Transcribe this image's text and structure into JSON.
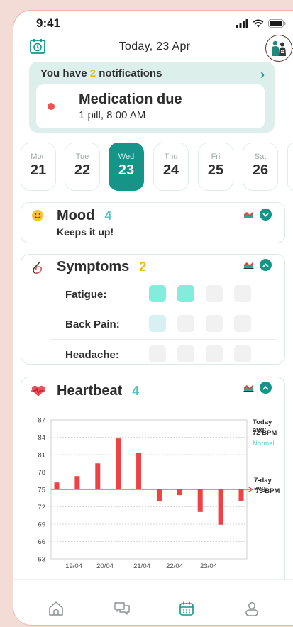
{
  "status": {
    "time": "9:41"
  },
  "header": {
    "date": "Today, 23 Apr"
  },
  "notifications": {
    "prefix": "You have",
    "count": "2",
    "suffix": "notifications",
    "item": {
      "title": "Medication due",
      "detail": "1 pill, 8:00 AM"
    }
  },
  "days": [
    {
      "name": "Mon",
      "num": "21",
      "active": false
    },
    {
      "name": "Tue",
      "num": "22",
      "active": false
    },
    {
      "name": "Wed",
      "num": "23",
      "active": true
    },
    {
      "name": "Thu",
      "num": "24",
      "active": false
    },
    {
      "name": "Fri",
      "num": "25",
      "active": false
    },
    {
      "name": "Sat",
      "num": "26",
      "active": false
    }
  ],
  "mood": {
    "title": "Mood",
    "value": "4",
    "note": "Keeps it up!"
  },
  "symptoms": {
    "title": "Symptoms",
    "value": "2",
    "rows": [
      {
        "label": "Fatigue:",
        "levels": [
          "teal",
          "teal",
          "none",
          "none"
        ]
      },
      {
        "label": "Back Pain:",
        "levels": [
          "light",
          "none",
          "none",
          "none"
        ]
      },
      {
        "label": "Headache:",
        "levels": [
          "none",
          "none",
          "none",
          "none"
        ]
      }
    ]
  },
  "heartbeat": {
    "title": "Heartbeat",
    "value": "4",
    "today_label": "Today avg:",
    "today_value": "72 BPM",
    "today_status": "Normal",
    "week_label": "7-day avg:",
    "week_value": "75 BPM"
  },
  "colors": {
    "accent": "#159488",
    "mood_value": "#58c6c0",
    "symptom_value": "#f2b71c",
    "heart_value": "#58c6c0",
    "bar": "#ef4146",
    "normal": "#59d3c8"
  },
  "chart_data": {
    "type": "bar",
    "baseline": 75,
    "ylim": [
      63,
      87
    ],
    "yticks": [
      63,
      66,
      69,
      72,
      75,
      78,
      81,
      84,
      87
    ],
    "xticks": [
      "19/04",
      "20/04",
      "21/04",
      "22/04",
      "23/04"
    ],
    "values": [
      76.2,
      77.3,
      79.5,
      83.8,
      81.3,
      73,
      74,
      71.1,
      68.9,
      73
    ],
    "avg_line": 75
  },
  "nav": [
    "home-icon",
    "chat-icon",
    "calendar-icon",
    "profile-icon"
  ]
}
